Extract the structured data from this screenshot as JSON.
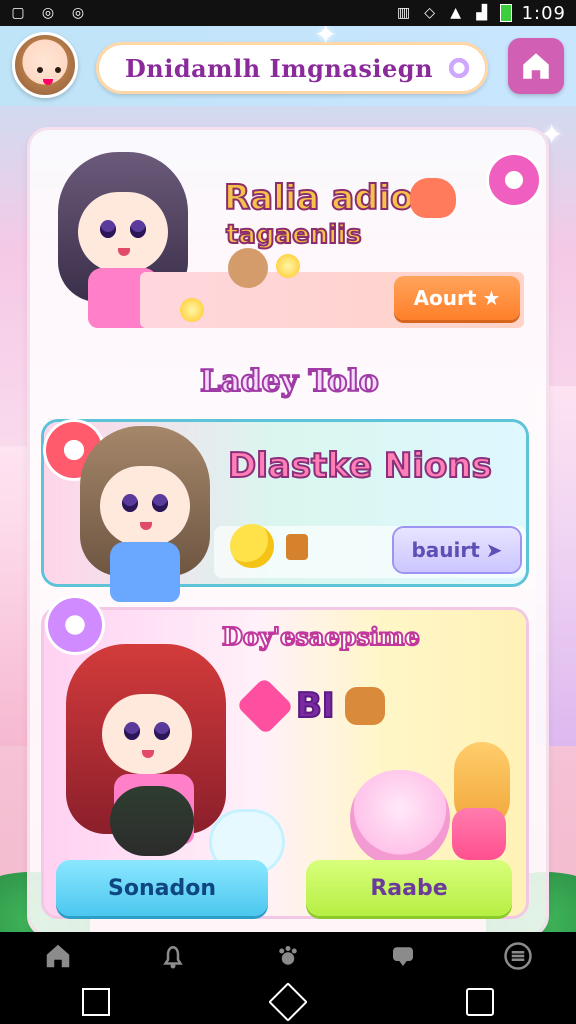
{
  "status_bar": {
    "time": "1:09"
  },
  "header": {
    "title": "Dnidamlh Imgnasiegn"
  },
  "section1": {
    "title_line1": "Ralia adio",
    "title_line2": "tagaeniis",
    "button_label": "Aourt"
  },
  "section2": {
    "title": "Dlastke Nions",
    "button_label": "bauirt"
  },
  "subtitle": "Ladey Tolo",
  "section3": {
    "title": "Doy'esaepsime",
    "icons_text": "BI",
    "button_left": "Sonadon",
    "button_right": "Raabe"
  },
  "nav": {
    "items": [
      "home-icon",
      "bell-icon",
      "paw-icon",
      "chat-icon",
      "menu-icon"
    ]
  }
}
